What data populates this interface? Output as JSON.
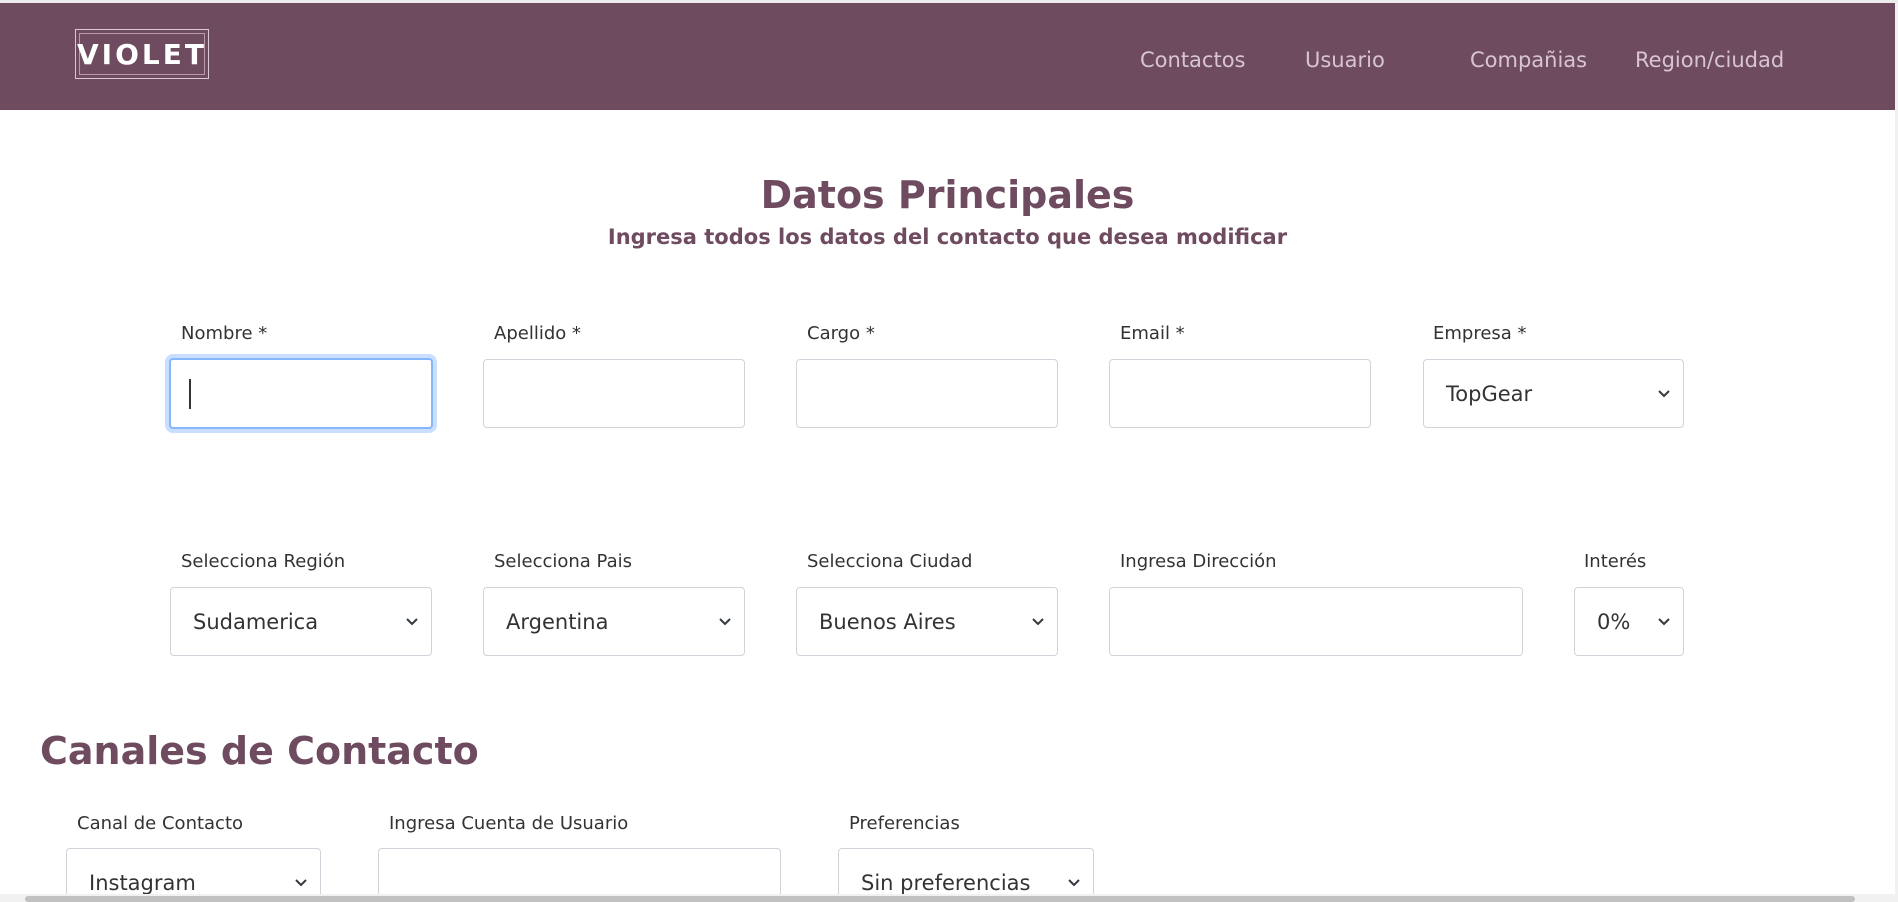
{
  "brand": {
    "logo_text": "VIOLET",
    "color": "#6f4b60"
  },
  "nav": {
    "items": [
      {
        "label": "Contactos"
      },
      {
        "label": "Usuario"
      },
      {
        "label": "Compañias"
      },
      {
        "label": "Region/ciudad"
      }
    ]
  },
  "main": {
    "title": "Datos Principales",
    "subtitle": "Ingresa todos los datos del contacto que desea modificar"
  },
  "form_row1": {
    "nombre": {
      "label": "Nombre *",
      "value": ""
    },
    "apellido": {
      "label": "Apellido *",
      "value": ""
    },
    "cargo": {
      "label": "Cargo *",
      "value": ""
    },
    "email": {
      "label": "Email *",
      "value": ""
    },
    "empresa": {
      "label": "Empresa *",
      "selected": "TopGear"
    }
  },
  "form_row2": {
    "region": {
      "label": "Selecciona Región",
      "selected": "Sudamerica"
    },
    "pais": {
      "label": "Selecciona Pais",
      "selected": "Argentina"
    },
    "ciudad": {
      "label": "Selecciona Ciudad",
      "selected": "Buenos Aires"
    },
    "direccion": {
      "label": "Ingresa Dirección",
      "value": ""
    },
    "interes": {
      "label": "Interés",
      "selected": "0%"
    }
  },
  "channels": {
    "title": "Canales de Contacto",
    "canal": {
      "label": "Canal de Contacto",
      "selected": "Instagram"
    },
    "cuenta": {
      "label": "Ingresa Cuenta de Usuario",
      "value": ""
    },
    "preferencias": {
      "label": "Preferencias",
      "selected": "Sin preferencias"
    }
  },
  "icons": {
    "select_arrow": "chevron-down-icon",
    "focus_color": "#86b7fe"
  }
}
